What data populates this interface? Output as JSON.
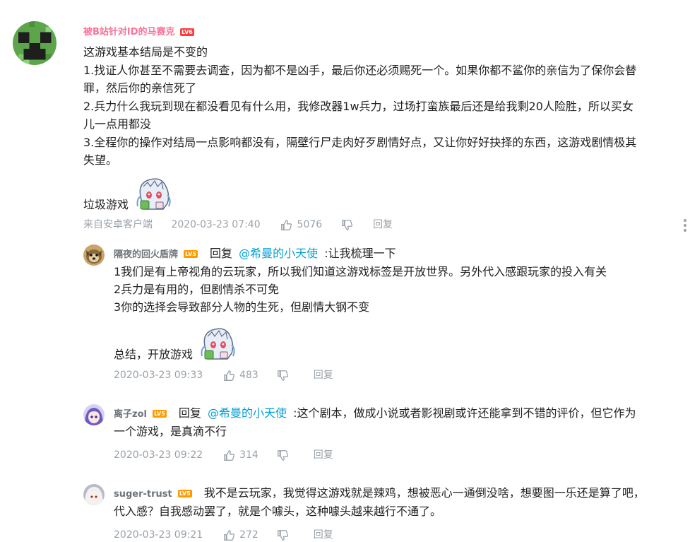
{
  "main_comment": {
    "username": "被B站针对ID的马赛克",
    "level": "LV6",
    "lines": [
      "这游戏基本结局是不变的",
      "1.找证人你甚至不需要去调查，因为都不是凶手，最后你还必须赐死一个。如果你都不鲨你的亲信为了保你会替",
      "罪，然后你的亲信死了",
      "2.兵力什么我玩到现在都没看见有什么用，我修改器1w兵力，过场打蛮族最后还是给我剩20人险胜，所以买女",
      "儿一点用都没",
      "3.全程你的操作对结局一点影响都没有，隔壁行尸走肉好歹剧情好点，又让你好好抉择的东西，这游戏剧情极其",
      "失望。"
    ],
    "closing": "垃圾游戏",
    "source": "来自安卓客户端",
    "time": "2020-03-23 07:40",
    "likes": "5076",
    "reply_label": "回复"
  },
  "replies": [
    {
      "username": "隔夜的回火盾牌",
      "level": "LV5",
      "reply_prefix": "回复",
      "mention": "@希曼的小天使",
      "first_line": ":让我梳理一下",
      "lines": [
        "1我们是有上帝视角的云玩家，所以我们知道这游戏标签是开放世界。另外代入感跟玩家的投入有关",
        "2兵力是有用的，但剧情杀不可免",
        "3你的选择会导致部分人物的生死，但剧情大钢不变"
      ],
      "closing": "总结，开放游戏",
      "time": "2020-03-23 09:33",
      "likes": "483",
      "reply_label": "回复"
    },
    {
      "username": "离子zol",
      "level": "LV5",
      "reply_prefix": "回复",
      "mention": "@希曼的小天使",
      "first_line": ":这个剧本，做成小说或者影视剧或许还能拿到不错的评价，但它作为",
      "lines": [
        "一个游戏，是真滴不行"
      ],
      "time": "2020-03-23 09:22",
      "likes": "314",
      "reply_label": "回复"
    },
    {
      "username": "suger-trust",
      "level": "LV5",
      "first_line": "我不是云玩家，我觉得这游戏就是辣鸡，想被恶心一通倒没啥，想要图一乐还是算了吧，",
      "lines": [
        "代入感？自我感动罢了，就是个噱头，这种噱头越来越行不通了。"
      ],
      "time": "2020-03-23 09:21",
      "likes": "272",
      "reply_label": "回复"
    }
  ],
  "colors": {
    "accent_link": "#00a1d6",
    "username_pink": "#fb7299",
    "meta_gray": "#99a2aa"
  },
  "icons": [
    "thumbs-up-icon",
    "thumbs-down-icon",
    "more-options-icon"
  ]
}
